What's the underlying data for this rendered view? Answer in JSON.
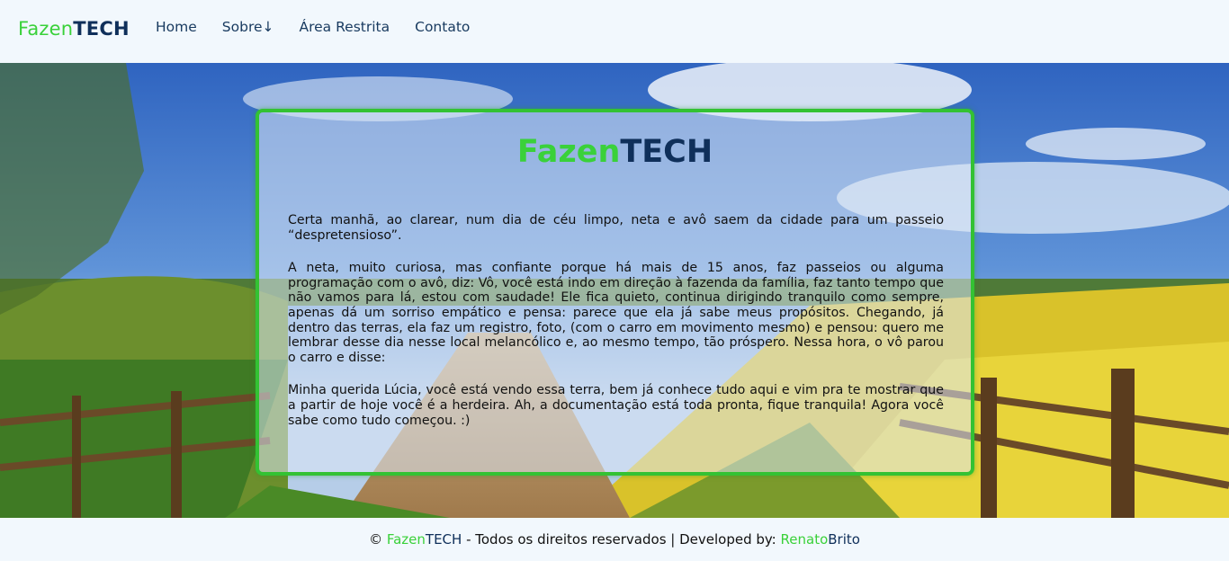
{
  "nav": {
    "brand_part1": "Fazen",
    "brand_part2": "TECH",
    "links": [
      "Home",
      "Sobre↓",
      "Área Restrita",
      "Contato"
    ]
  },
  "card": {
    "title_part1": "Fazen",
    "title_part2": "TECH",
    "paragraphs": [
      "Certa manhã, ao clarear, num dia de céu limpo, neta e avô saem da cidade para um passeio “despretensioso”.",
      "A neta, muito curiosa, mas confiante porque há mais de 15 anos, faz passeios ou alguma programação com o avô, diz: Vô, você está indo em direção à fazenda da família, faz tanto tempo que não vamos para lá, estou com saudade! Ele fica quieto, continua dirigindo tranquilo como sempre, apenas dá um sorriso empático e pensa: parece que ela já sabe meus propósitos. Chegando, já dentro das terras, ela faz um registro, foto, (com o carro em movimento mesmo) e pensou: quero me lembrar desse dia nesse local melancólico e, ao mesmo tempo, tão próspero. Nessa hora, o vô parou o carro e disse:",
      "Minha querida Lúcia, você está vendo essa terra, bem já conhece tudo aqui e vim pra te mostrar que a partir de hoje você é a herdeira. Ah, a documentação está toda pronta, fique tranquila! Agora você sabe como tudo começou. :)"
    ]
  },
  "footer": {
    "copyright": "©",
    "brand_part1": "Fazen",
    "brand_part2": "TECH",
    "rights": " - Todos os direitos reservados | Developed by: ",
    "dev_part1": "Renato",
    "dev_part2": "Brito"
  },
  "colors": {
    "brand_green": "#3ad13a",
    "brand_navy": "#0f2f5a",
    "card_border": "#33c233",
    "page_bg": "#f2f8fd"
  }
}
